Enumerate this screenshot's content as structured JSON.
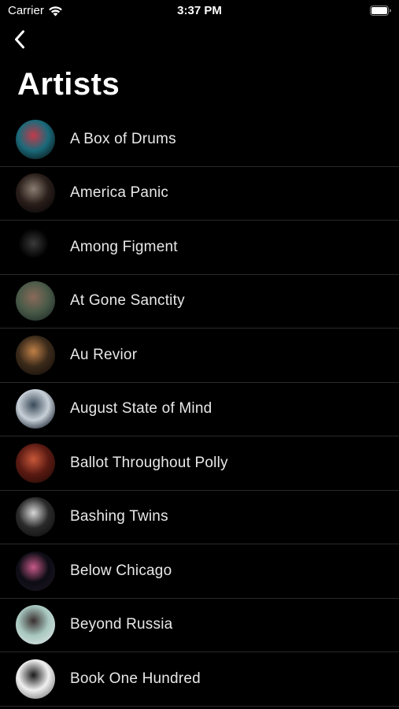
{
  "status_bar": {
    "carrier": "Carrier",
    "time": "3:37 PM"
  },
  "nav": {
    "back_icon": "chevron-left-icon"
  },
  "page": {
    "title": "Artists"
  },
  "colors": {
    "background": "#000000",
    "separator": "#2a2a2c",
    "text": "#e8e8e8"
  },
  "artists": [
    {
      "name": "A Box of Drums",
      "thumb": [
        "#1a6a7a",
        "#c23a4a",
        "#0c1a1e"
      ]
    },
    {
      "name": "America Panic",
      "thumb": [
        "#2a1e1a",
        "#8a7e72",
        "#0a0808"
      ]
    },
    {
      "name": "Among Figment",
      "thumb": [
        "#000000",
        "#3a3a3a",
        "#000000"
      ]
    },
    {
      "name": "At Gone Sanctity",
      "thumb": [
        "#4a5a48",
        "#8a6a5a",
        "#22302a"
      ]
    },
    {
      "name": "Au Revior",
      "thumb": [
        "#3a2a1a",
        "#c08048",
        "#1a120c"
      ]
    },
    {
      "name": "August State of Mind",
      "thumb": [
        "#c8d0d8",
        "#3a4a58",
        "#1a2430"
      ]
    },
    {
      "name": "Ballot Throughout Polly",
      "thumb": [
        "#5a1a12",
        "#c8583a",
        "#2a0c08"
      ]
    },
    {
      "name": "Bashing Twins",
      "thumb": [
        "#2a2a2a",
        "#d8d8d8",
        "#101010"
      ]
    },
    {
      "name": "Below Chicago",
      "thumb": [
        "#0c0c14",
        "#c85a8a",
        "#1a1420"
      ]
    },
    {
      "name": "Beyond Russia",
      "thumb": [
        "#a8c8c0",
        "#3a3030",
        "#d8e0e0"
      ]
    },
    {
      "name": "Book One Hundred",
      "thumb": [
        "#f0f0f0",
        "#1a1a1a",
        "#808080"
      ]
    }
  ]
}
